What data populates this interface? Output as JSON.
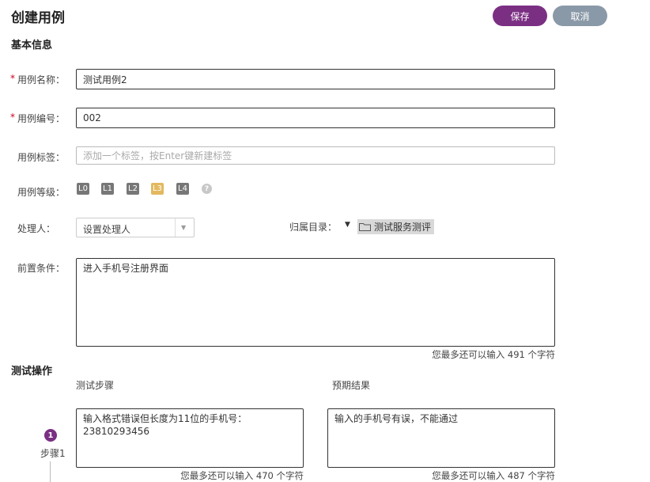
{
  "header": {
    "title": "创建用例",
    "save_label": "保存",
    "cancel_label": "取消"
  },
  "basic_info": {
    "section_title": "基本信息",
    "name": {
      "label": "用例名称：",
      "value": "测试用例2",
      "required": "*"
    },
    "number": {
      "label": "用例编号：",
      "value": "002",
      "required": "*"
    },
    "tags": {
      "label": "用例标签：",
      "placeholder": "添加一个标签，按Enter键新建标签"
    },
    "level": {
      "label": "用例等级：",
      "options": [
        "L0",
        "L1",
        "L2",
        "L3",
        "L4"
      ],
      "selected": "L3",
      "help_icon": "question-circle-icon",
      "help_glyph": "?"
    },
    "handler": {
      "label": "处理人：",
      "value": "设置处理人"
    },
    "directory": {
      "label": "归属目录：",
      "value": "测试服务测评"
    },
    "precondition": {
      "label": "前置条件：",
      "value": "进入手机号注册界面",
      "counter": "您最多还可以输入 491 个字符"
    }
  },
  "test_ops": {
    "section_title": "测试操作",
    "steps_header": "测试步骤",
    "expected_header": "预期结果",
    "steps": [
      {
        "number": "1",
        "label": "步骤1",
        "step_text": "输入格式错误但长度为11位的手机号：\n23810293456",
        "step_counter": "您最多还可以输入 470 个字符",
        "expected_text": "输入的手机号有误，不能通过",
        "expected_counter": "您最多还可以输入 487 个字符"
      }
    ]
  },
  "colors": {
    "accent": "#7b2f83",
    "cancel": "#8a99a8",
    "level_active": "#e3b85f",
    "level_default": "#777777",
    "required": "#d0021b"
  }
}
